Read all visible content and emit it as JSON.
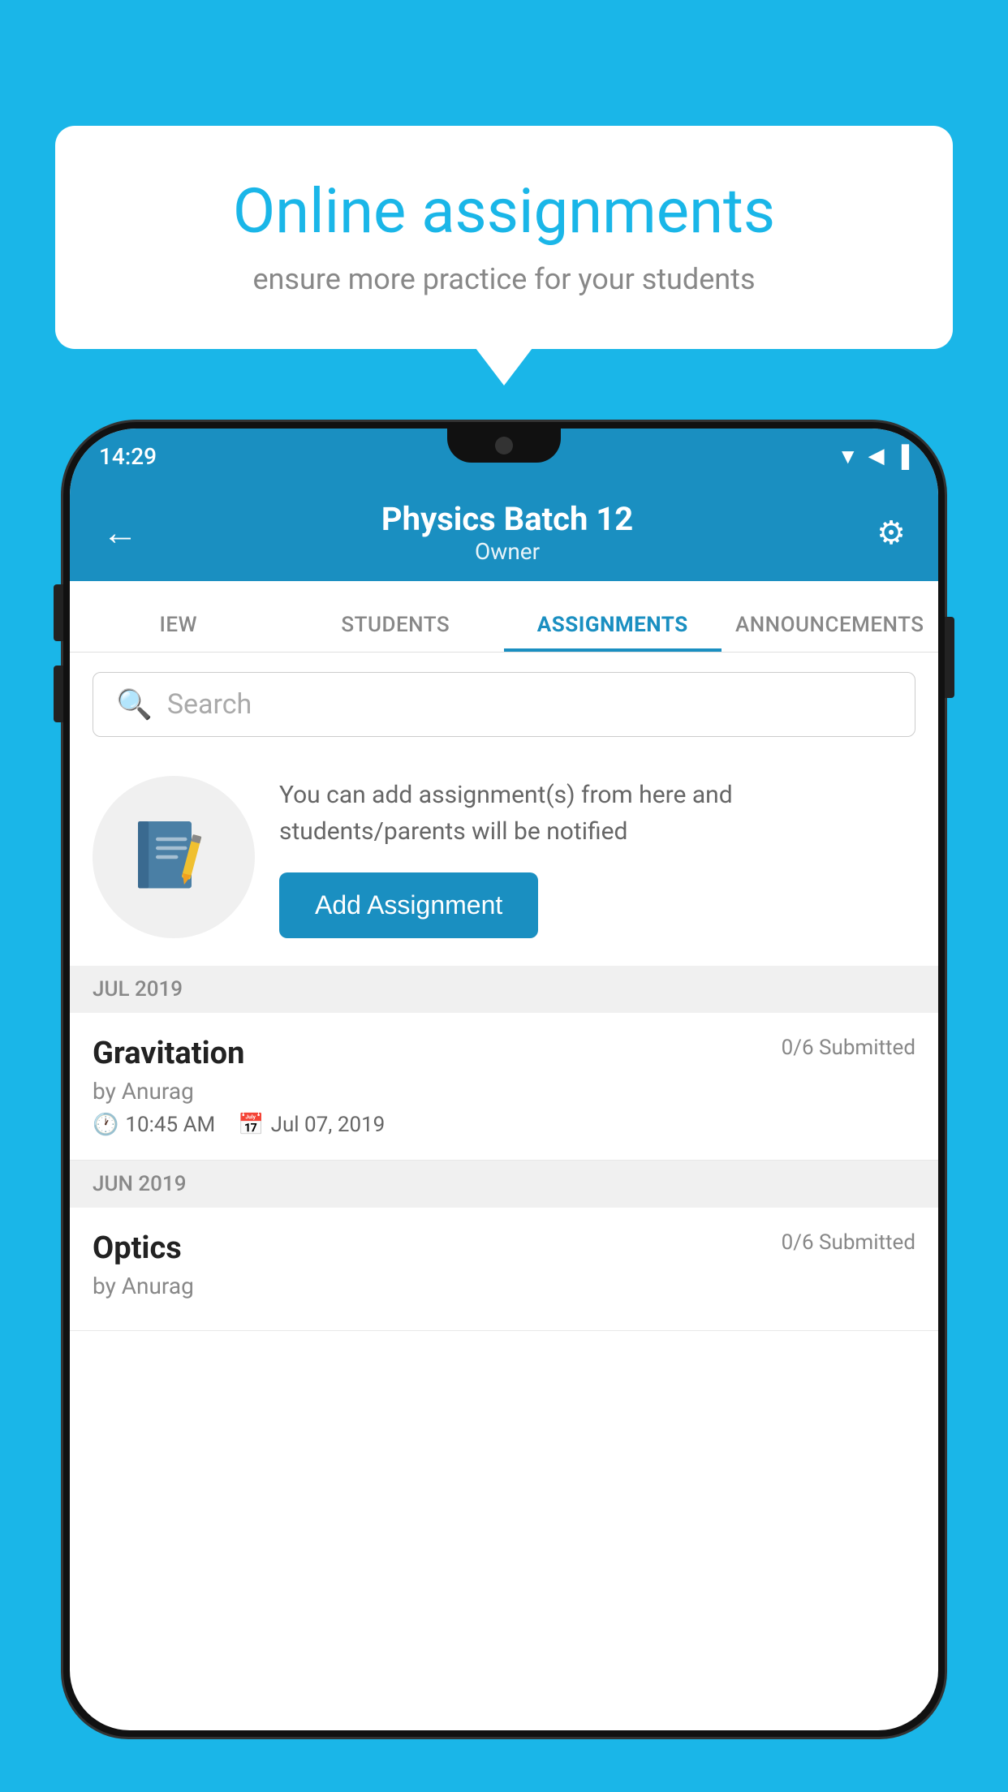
{
  "background_color": "#1ab6e8",
  "speech_bubble": {
    "title": "Online assignments",
    "subtitle": "ensure more practice for your students"
  },
  "status_bar": {
    "time": "14:29",
    "wifi": "▲",
    "signal": "▲",
    "battery": "▪"
  },
  "header": {
    "title": "Physics Batch 12",
    "subtitle": "Owner",
    "back_label": "←",
    "settings_label": "⚙"
  },
  "tabs": [
    {
      "label": "IEW",
      "active": false
    },
    {
      "label": "STUDENTS",
      "active": false
    },
    {
      "label": "ASSIGNMENTS",
      "active": true
    },
    {
      "label": "ANNOUNCEMENTS",
      "active": false
    }
  ],
  "search": {
    "placeholder": "Search"
  },
  "info_section": {
    "text": "You can add assignment(s) from here and students/parents will be notified",
    "button_label": "Add Assignment"
  },
  "assignments": [
    {
      "month_label": "JUL 2019",
      "title": "Gravitation",
      "submitted": "0/6 Submitted",
      "by": "by Anurag",
      "time": "10:45 AM",
      "date": "Jul 07, 2019"
    },
    {
      "month_label": "JUN 2019",
      "title": "Optics",
      "submitted": "0/6 Submitted",
      "by": "by Anurag",
      "time": "",
      "date": ""
    }
  ]
}
